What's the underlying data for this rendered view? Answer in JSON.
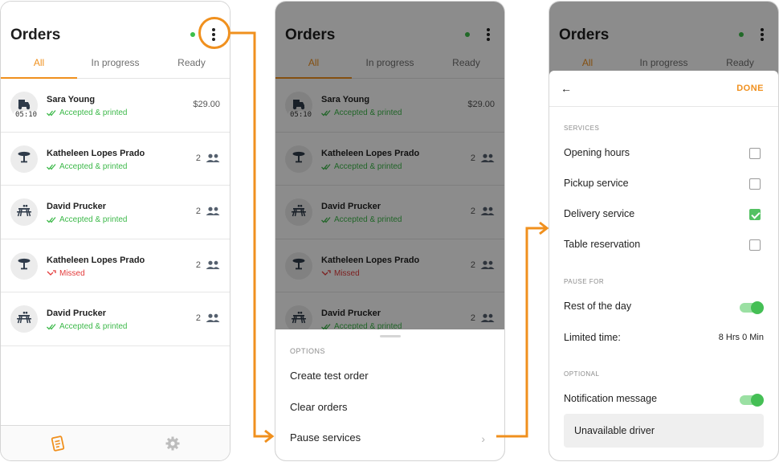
{
  "colors": {
    "accent": "#f0901e",
    "success": "#3db94a",
    "danger": "#e33b3b"
  },
  "header": {
    "title": "Orders"
  },
  "tabs": [
    "All",
    "In progress",
    "Ready"
  ],
  "orders": [
    {
      "name": "Sara Young",
      "status": "Accepted & printed",
      "status_type": "ok",
      "icon": "scooter-icon",
      "time": "05:10",
      "right": "$29.00",
      "right_type": "price"
    },
    {
      "name": "Katheleen Lopes Prado",
      "status": "Accepted & printed",
      "status_type": "ok",
      "icon": "table-icon",
      "right": "2",
      "right_type": "guests"
    },
    {
      "name": "David Prucker",
      "status": "Accepted & printed",
      "status_type": "ok",
      "icon": "picnic-table-icon",
      "right": "2",
      "right_type": "guests"
    },
    {
      "name": "Katheleen Lopes Prado",
      "status": "Missed",
      "status_type": "missed",
      "icon": "table-icon",
      "right": "2",
      "right_type": "guests"
    },
    {
      "name": "David Prucker",
      "status": "Accepted & printed",
      "status_type": "ok",
      "icon": "picnic-table-icon",
      "right": "2",
      "right_type": "guests"
    }
  ],
  "bottom_nav": [
    "orders-icon",
    "settings-gear-icon"
  ],
  "options_sheet": {
    "label": "OPTIONS",
    "items": [
      "Create test order",
      "Clear orders",
      "Pause services"
    ]
  },
  "services_panel": {
    "back_icon": "back-arrow-icon",
    "done": "DONE",
    "services_label": "SERVICES",
    "services": [
      {
        "label": "Opening hours",
        "checked": false
      },
      {
        "label": "Pickup service",
        "checked": false
      },
      {
        "label": "Delivery service",
        "checked": true
      },
      {
        "label": "Table reservation",
        "checked": false
      }
    ],
    "pause_label": "PAUSE FOR",
    "rest_of_day": "Rest of the day",
    "rest_of_day_on": true,
    "limited_time": "Limited time:",
    "limited_time_value": "8 Hrs 0 Min",
    "optional_label": "OPTIONAL",
    "notification": "Notification message",
    "notification_on": true,
    "message": "Unavailable driver"
  }
}
